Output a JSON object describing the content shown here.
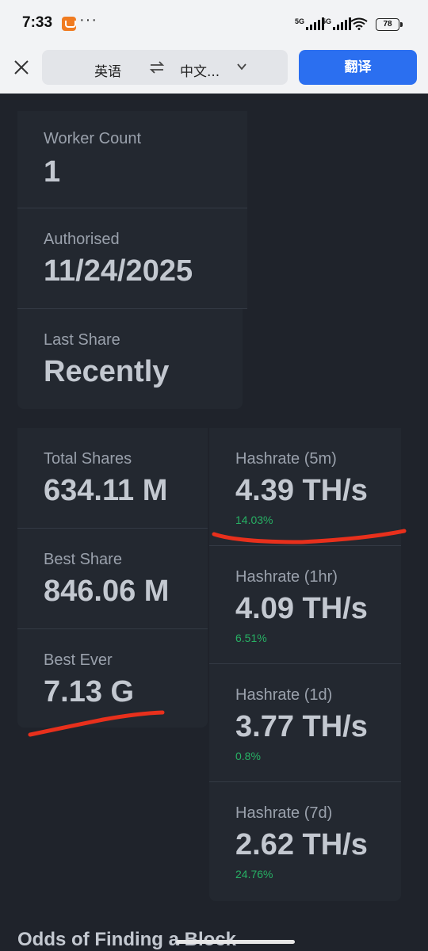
{
  "status": {
    "time": "7:33",
    "sim1": "5G",
    "sim2": "5G",
    "battery": "78"
  },
  "translate": {
    "source_lang": "英语",
    "target_lang": "中文...",
    "button": "翻译"
  },
  "stats": {
    "worker_count": {
      "label": "Worker Count",
      "value": "1"
    },
    "authorised": {
      "label": "Authorised",
      "value": "11/24/2025"
    },
    "last_share": {
      "label": "Last Share",
      "value": "Recently"
    },
    "total_shares": {
      "label": "Total Shares",
      "value": "634.11 M"
    },
    "best_share": {
      "label": "Best Share",
      "value": "846.06 M"
    },
    "best_ever": {
      "label": "Best Ever",
      "value": "7.13 G"
    }
  },
  "hashrates": [
    {
      "label": "Hashrate (5m)",
      "value": "4.39 TH/s",
      "change": "14.03%"
    },
    {
      "label": "Hashrate (1hr)",
      "value": "4.09 TH/s",
      "change": "6.51%"
    },
    {
      "label": "Hashrate (1d)",
      "value": "3.77 TH/s",
      "change": "0.8%"
    },
    {
      "label": "Hashrate (7d)",
      "value": "2.62 TH/s",
      "change": "24.76%"
    }
  ],
  "section_title": "Odds of Finding a Block",
  "colors": {
    "background": "#1f232b",
    "card": "#232830",
    "positive": "#27b064",
    "accent": "#2b6ff0",
    "annotation": "#e8301c"
  }
}
